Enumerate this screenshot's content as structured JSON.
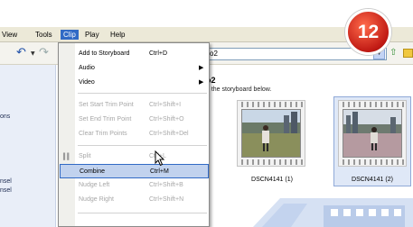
{
  "menubar": {
    "items": [
      "View",
      "Tools",
      "Clip",
      "Play",
      "Help"
    ],
    "active": "Clip"
  },
  "toolbar": {
    "path_value": "o2"
  },
  "tasks": {
    "items": [
      "ons",
      "nsel",
      "nsel"
    ]
  },
  "main": {
    "heading": "o2",
    "subheading": "n the storyboard below.",
    "clips": [
      {
        "label": "DSCN4141 (1)"
      },
      {
        "label": "DSCN4141 (2)"
      }
    ]
  },
  "clip_menu": {
    "items": [
      {
        "label": "Add to Storyboard",
        "shortcut": "Ctrl+D"
      },
      {
        "label": "Audio"
      },
      {
        "label": "Video"
      },
      {
        "label": "Set Start Trim Point",
        "shortcut": "Ctrl+Shift+I"
      },
      {
        "label": "Set End Trim Point",
        "shortcut": "Ctrl+Shift+O"
      },
      {
        "label": "Clear Trim Points",
        "shortcut": "Ctrl+Shift+Del"
      },
      {
        "label": "Split",
        "shortcut": "Ctrl+L"
      },
      {
        "label": "Combine",
        "shortcut": "Ctrl+M"
      },
      {
        "label": "Nudge Left",
        "shortcut": "Ctrl+Shift+B"
      },
      {
        "label": "Nudge Right",
        "shortcut": "Ctrl+Shift+N"
      }
    ]
  },
  "badge": {
    "number": "12"
  },
  "colors": {
    "menu_highlight": "#316ac5",
    "selected_item": "#c1d2ee",
    "badge": "#d3221b"
  }
}
